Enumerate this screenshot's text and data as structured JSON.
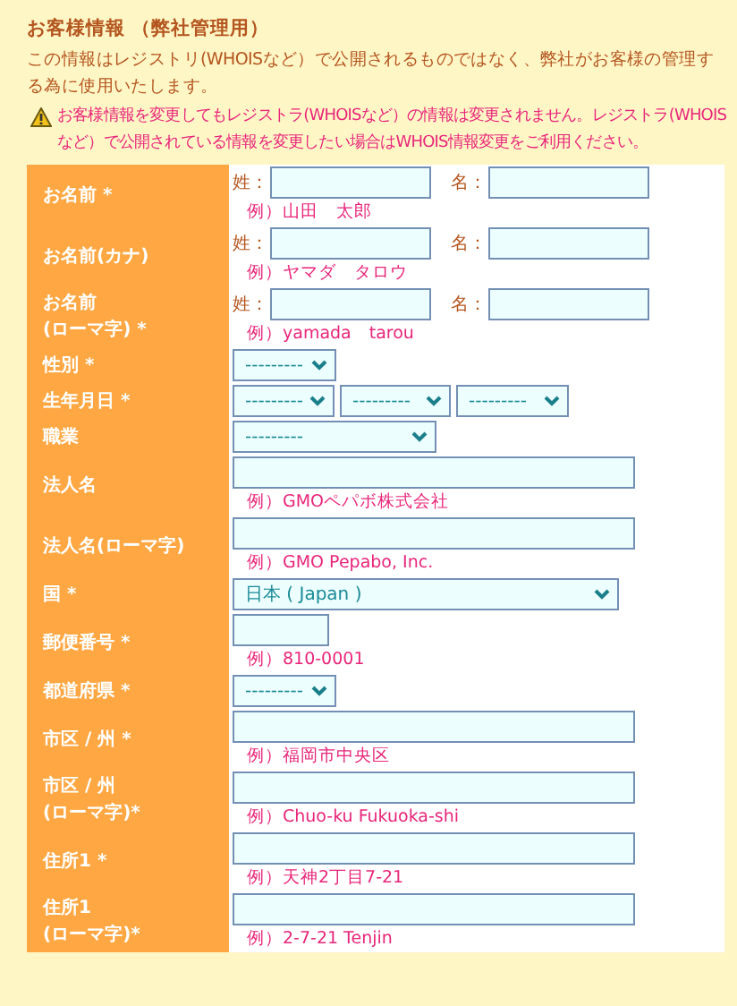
{
  "section_title": "お客様情報 （弊社管理用）",
  "description": "この情報はレジストリ(WHOISなど）で公開されるものではなく、弊社がお客様の管理する為に使用いたします。",
  "warning": "お客様情報を変更してもレジストラ(WHOISなど）の情報は変更されません。レジストラ(WHOISなど）で公開されている情報を変更したい場合はWHOIS情報変更をご利用ください。",
  "rows": [
    {
      "label": "お名前 *",
      "kind": "name",
      "fields": [
        {
          "prefix": "姓："
        },
        {
          "prefix": "名："
        }
      ],
      "example": "例）山田　太郎"
    },
    {
      "label": "お名前(カナ)",
      "kind": "name",
      "fields": [
        {
          "prefix": "姓："
        },
        {
          "prefix": "名："
        }
      ],
      "example": "例）ヤマダ　タロウ"
    },
    {
      "label": "お名前\n(ローマ字) *",
      "kind": "name",
      "fields": [
        {
          "prefix": "姓："
        },
        {
          "prefix": "名："
        }
      ],
      "example": "例）yamada　tarou"
    },
    {
      "label": "性別 *",
      "kind": "short-select",
      "selects": [
        {
          "value": "---------"
        }
      ]
    },
    {
      "label": "生年月日 *",
      "kind": "date",
      "selects": [
        {
          "value": "---------"
        },
        {
          "value": "---------"
        },
        {
          "value": "---------"
        }
      ]
    },
    {
      "label": "職業",
      "kind": "wide-select",
      "selects": [
        {
          "value": "---------"
        }
      ]
    },
    {
      "label": "法人名",
      "kind": "text",
      "example": "例）GMOペパボ株式会社"
    },
    {
      "label": "法人名(ローマ字)",
      "kind": "text",
      "example": "例）GMO Pepabo, Inc."
    },
    {
      "label": "国 *",
      "kind": "country",
      "selects": [
        {
          "value": "日本 ( Japan )"
        }
      ]
    },
    {
      "label": "郵便番号 *",
      "kind": "postal",
      "example": "例）810-0001"
    },
    {
      "label": "都道府県 *",
      "kind": "short-select",
      "selects": [
        {
          "value": "---------"
        }
      ]
    },
    {
      "label": "市区 / 州 *",
      "kind": "text",
      "example": "例）福岡市中央区"
    },
    {
      "label": "市区 / 州\n(ローマ字)*",
      "kind": "text",
      "example": "例）Chuo-ku Fukuoka-shi"
    },
    {
      "label": "住所1 *",
      "kind": "text",
      "example": "例）天神2丁目7-21"
    },
    {
      "label": "住所1\n(ローマ字)*",
      "kind": "text",
      "example": "例）2-7-21 Tenjin"
    }
  ]
}
